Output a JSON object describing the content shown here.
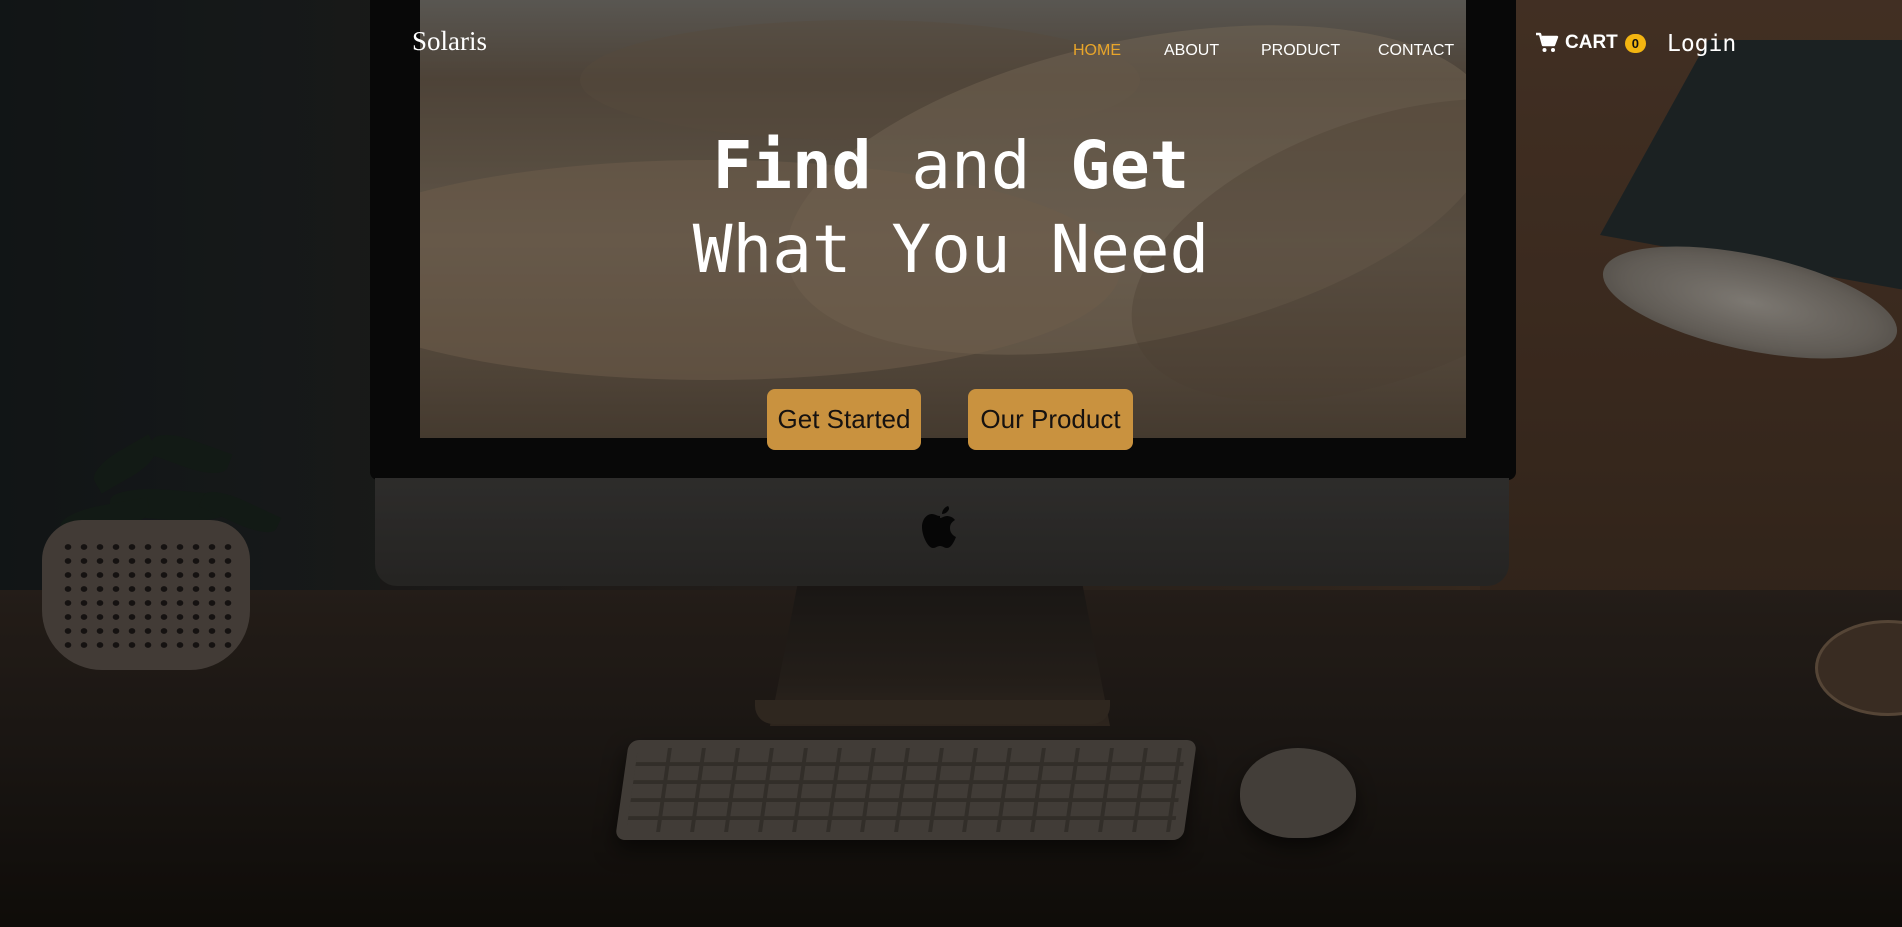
{
  "brand": {
    "name": "Solaris"
  },
  "nav": {
    "items": [
      {
        "label": "HOME",
        "active": true
      },
      {
        "label": "ABOUT",
        "active": false
      },
      {
        "label": "PRODUCT",
        "active": false
      },
      {
        "label": "CONTACT",
        "active": false
      }
    ],
    "active_color": "#e8a52a"
  },
  "cart": {
    "label": "CART",
    "count": "0",
    "icon": "cart-icon",
    "badge_color": "#f3b511"
  },
  "login": {
    "label": "Login"
  },
  "hero": {
    "title_word_1": "Find",
    "title_word_2": " and ",
    "title_word_3": "Get",
    "title_line_2": "What You Need",
    "primary_button": "Get Started",
    "secondary_button": "Our Product",
    "button_color": "#c9923f"
  }
}
